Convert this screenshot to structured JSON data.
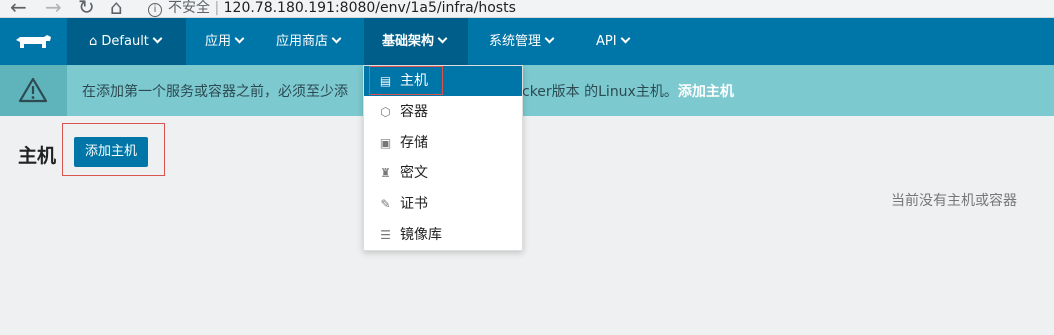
{
  "browser": {
    "back": "←",
    "forward": "→",
    "reload": "↻",
    "home": "⌂",
    "security": "不安全",
    "url": "120.78.180.191:8080/env/1a5/infra/hosts"
  },
  "header": {
    "environment": "Default",
    "nav": [
      "应用",
      "应用商店",
      "基础架构",
      "系统管理",
      "API"
    ]
  },
  "alert": {
    "text_before": "在添加第一个服务或容器之前，必须至少添",
    "text_after": "cker版本 的Linux主机。",
    "link": "添加主机"
  },
  "page": {
    "title": "主机",
    "add_button": "添加主机",
    "empty": "当前没有主机或容器"
  },
  "dropdown": {
    "items": [
      {
        "label": "主机",
        "icon": "server-icon"
      },
      {
        "label": "容器",
        "icon": "cube-icon"
      },
      {
        "label": "存储",
        "icon": "storage-icon"
      },
      {
        "label": "密文",
        "icon": "secret-icon"
      },
      {
        "label": "证书",
        "icon": "certificate-icon"
      },
      {
        "label": "镜像库",
        "icon": "database-icon"
      }
    ]
  },
  "colors": {
    "header": "#0075a8",
    "header_active": "#005f8a",
    "alert": "#7cc9cf",
    "highlight": "#d9534f"
  }
}
